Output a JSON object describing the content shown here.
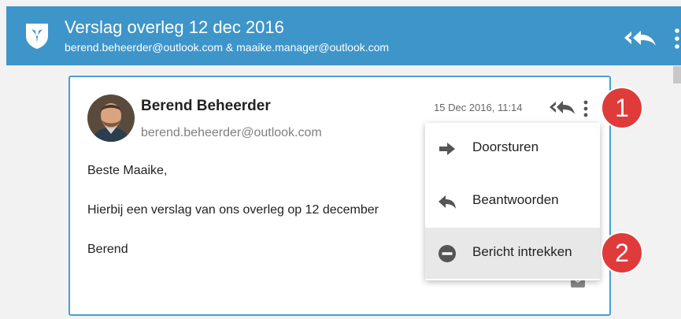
{
  "header": {
    "title": "Verslag overleg 12 dec 2016",
    "subtitle": "berend.beheerder@outlook.com & maaike.manager@outlook.com",
    "logo_icon": "shield-bird-icon",
    "actions": [
      "reply-all-icon",
      "more-vert-icon"
    ]
  },
  "message": {
    "sender_name": "Berend Beheerder",
    "sender_email": "berend.beheerder@outlook.com",
    "date": "15 Dec 2016, 11:14",
    "body": {
      "greeting": "Beste Maaike,",
      "line": "Hierbij een verslag van ons overleg op 12 december",
      "signature": "Berend"
    }
  },
  "menu": {
    "items": [
      {
        "label": "Doorsturen",
        "icon": "arrow-forward-icon"
      },
      {
        "label": "Beantwoorden",
        "icon": "reply-icon"
      },
      {
        "label": "Bericht intrekken",
        "icon": "minus-circle-icon"
      }
    ]
  },
  "markers": [
    "1",
    "2"
  ],
  "colors": {
    "header_bg": "#3e95c9",
    "card_border": "#4a9ed3",
    "marker_bg": "#e03b3b",
    "menu_highlight": "#e8e8e8"
  }
}
